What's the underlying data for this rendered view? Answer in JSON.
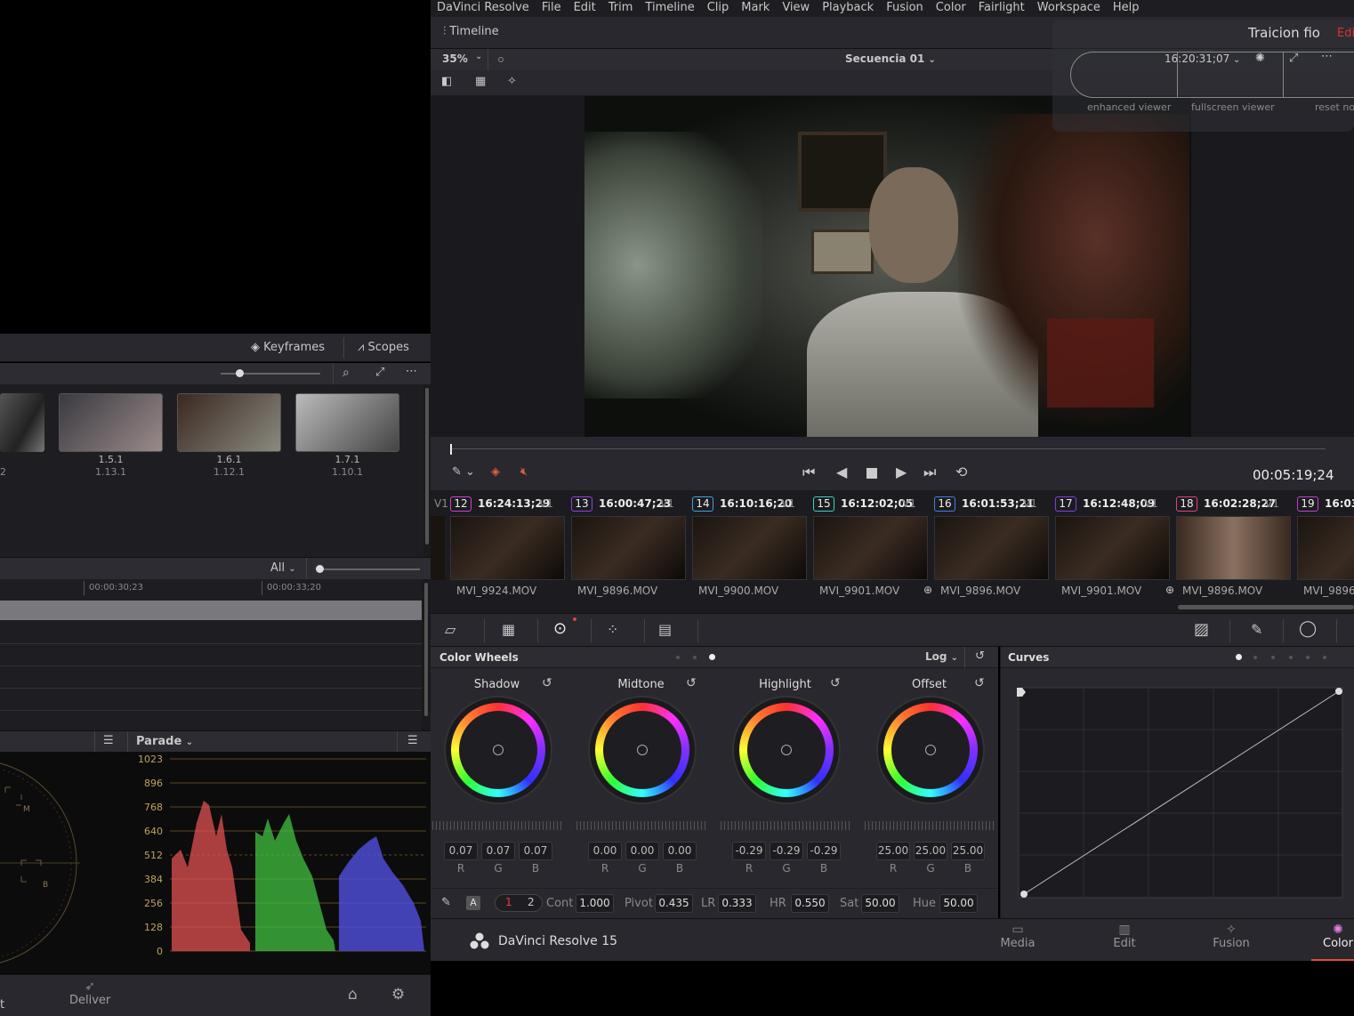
{
  "menu": [
    "DaVinci Resolve",
    "File",
    "Edit",
    "Trim",
    "Timeline",
    "Clip",
    "Mark",
    "View",
    "Playback",
    "Fusion",
    "Color",
    "Fairlight",
    "Workspace",
    "Help"
  ],
  "left": {
    "keyframes": "Keyframes",
    "scopes": "Scopes",
    "gallery": [
      {
        "a": "1.5.1",
        "b": "1.13.1"
      },
      {
        "a": "1.6.1",
        "b": "1.12.1"
      },
      {
        "a": "1.7.1",
        "b": "1.10.1"
      }
    ],
    "gallery_partial": "2",
    "kf_filter": "All",
    "kf_times": [
      "00:00:30;23",
      "00:00:33;20"
    ],
    "parade_label": "Parade",
    "parade_ticks": [
      "1023",
      "896",
      "768",
      "640",
      "512",
      "384",
      "256",
      "128",
      "0"
    ],
    "vec_labels": [
      "M",
      "B"
    ],
    "deliver": "Deliver",
    "edge_letter": "t"
  },
  "viewer": {
    "timeline_label": "Timeline",
    "zoom": "35%",
    "sequence": "Secuencia 01",
    "project": "Traicion fio",
    "project_edge": "Edi",
    "tc_header": "16:20:31;07",
    "overlay": [
      "enhanced viewer",
      "fullscreen viewer",
      "reset no"
    ],
    "timecode": "00:05:19;24"
  },
  "clips": [
    {
      "track": "V1",
      "num": "12",
      "tc": "16:24:13;29",
      "name": "MVI_9924.MOV",
      "c": "#d040d0"
    },
    {
      "track": "V1",
      "num": "13",
      "tc": "16:00:47;23",
      "name": "MVI_9896.MOV",
      "c": "#9040e0"
    },
    {
      "track": "V1",
      "num": "14",
      "tc": "16:10:16;20",
      "name": "MVI_9900.MOV",
      "c": "#40a0e0"
    },
    {
      "track": "V1",
      "num": "15",
      "tc": "16:12:02;05",
      "name": "MVI_9901.MOV",
      "c": "#40d0c0"
    },
    {
      "track": "V1",
      "num": "16",
      "tc": "16:01:53;21",
      "name": "MVI_9896.MOV",
      "c": "#4080e0"
    },
    {
      "track": "V1",
      "num": "17",
      "tc": "16:12:48;09",
      "name": "MVI_9901.MOV",
      "c": "#8040e0"
    },
    {
      "track": "V1",
      "num": "18",
      "tc": "16:02:28;27",
      "name": "MVI_9896.MOV",
      "c": "#e04080"
    },
    {
      "track": "V1",
      "num": "19",
      "tc": "16:03",
      "name": "MVI_9896.I",
      "c": "#c040d0"
    }
  ],
  "clip_track_prefix": "V1",
  "wheels": {
    "title": "Color Wheels",
    "mode": "Log",
    "items": [
      {
        "name": "Shadow",
        "r": "0.07",
        "g": "0.07",
        "b": "0.07"
      },
      {
        "name": "Midtone",
        "r": "0.00",
        "g": "0.00",
        "b": "0.00"
      },
      {
        "name": "Highlight",
        "r": "-0.29",
        "g": "-0.29",
        "b": "-0.29"
      },
      {
        "name": "Offset",
        "r": "25.00",
        "g": "25.00",
        "b": "25.00"
      }
    ],
    "rgb": [
      "R",
      "G",
      "B"
    ],
    "a_badge": "A",
    "page1": "1",
    "page2": "2",
    "params": [
      {
        "label": "Cont",
        "value": "1.000"
      },
      {
        "label": "Pivot",
        "value": "0.435"
      },
      {
        "label": "LR",
        "value": "0.333"
      },
      {
        "label": "HR",
        "value": "0.550"
      },
      {
        "label": "Sat",
        "value": "50.00"
      },
      {
        "label": "Hue",
        "value": "50.00"
      }
    ]
  },
  "curves": {
    "title": "Curves"
  },
  "footer": {
    "app": "DaVinci Resolve 15",
    "pages": [
      "Media",
      "Edit",
      "Fusion",
      "Color"
    ]
  }
}
